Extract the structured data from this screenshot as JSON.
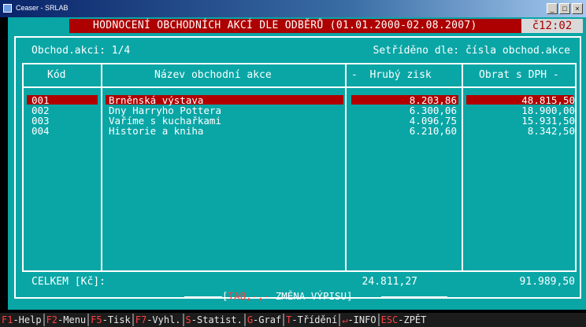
{
  "window": {
    "title": "Ceaser - SRLAB",
    "buttons": [
      "_",
      "□",
      "×"
    ]
  },
  "header": {
    "title": "HODNOCENÍ OBCHODNÍCH AKCÍ DLE ODBĚRŮ (01.01.2000-02.08.2007)",
    "time": "č12:02"
  },
  "info": {
    "counter": "Obchod.akci: 1/4",
    "sort": "Setříděno dle: čísla obchod.akce"
  },
  "table": {
    "columns": {
      "code": "Kód",
      "name": "Název obchodní akce",
      "gross": "-  Hrubý zisk",
      "turnover": "Obrat s DPH -"
    },
    "rows": [
      {
        "code": "001",
        "name": "Brněnská výstava",
        "gross": "8.203,86",
        "turnover": "48.815,50",
        "selected": true
      },
      {
        "code": "002",
        "name": "Dny Harryho Pottera",
        "gross": "6.300,06",
        "turnover": "18.900,00"
      },
      {
        "code": "003",
        "name": "Vaříme s kuchařkami",
        "gross": "4.096,75",
        "turnover": "15.931,50"
      },
      {
        "code": "004",
        "name": "Historie a kniha",
        "gross": "6.210,60",
        "turnover": "8.342,50"
      }
    ]
  },
  "totals": {
    "label": "CELKEM [Kč]:",
    "gross": "24.811,27",
    "turnover": "91.989,50"
  },
  "hint": {
    "open": "[",
    "keys": "TAB,-,-",
    "text": " ZMĚNA VÝPISU]"
  },
  "fkeys": [
    {
      "key": "F1",
      "label": "-Help"
    },
    {
      "key": "F2",
      "label": "-Menu"
    },
    {
      "key": "F5",
      "label": "-Tisk"
    },
    {
      "key": "F7",
      "label": "-Vyhl."
    },
    {
      "key": "S",
      "label": "-Statist."
    },
    {
      "key": "G",
      "label": "-Graf"
    },
    {
      "key": "T",
      "label": "-Třídění"
    },
    {
      "key": "↵",
      "label": "-INFO"
    },
    {
      "key": "ESC",
      "label": "-ZPĚT"
    }
  ]
}
